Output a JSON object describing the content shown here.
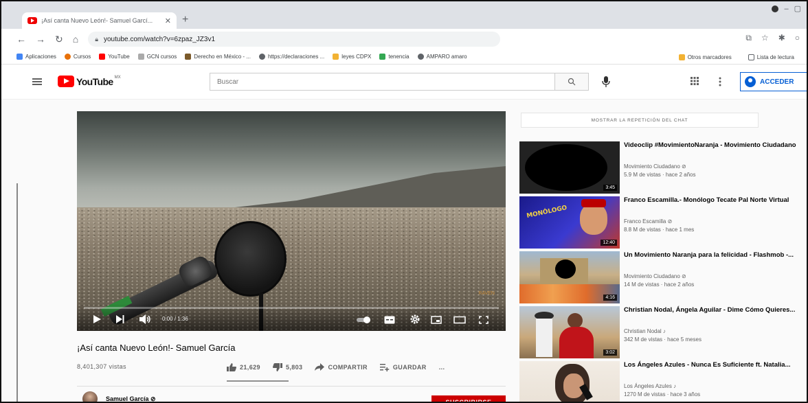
{
  "browser": {
    "tab_title": "¡Así canta Nuevo León!- Samuel Garcí... ",
    "tab_close": "✕",
    "new_tab": "+",
    "url": "youtube.com/watch?v=6zpaz_JZ3v1",
    "bookmarks": [
      "Aplicaciones",
      "Cursos",
      "YouTube",
      "GCN cursos",
      "Derecho en México - ...",
      "https://declaraciones ...",
      "leyes CDPX",
      "tenencia",
      "AMPARO amaro"
    ],
    "bookmarks_right": [
      "Otros marcadores",
      "Lista de lectura"
    ]
  },
  "youtube": {
    "logo_text": "YouTube",
    "logo_country": "MX",
    "search_placeholder": "Buscar",
    "signin_label": "ACCEDER"
  },
  "player": {
    "time": "0:00 / 1:36",
    "progress": 0.0,
    "watermark": "RAVEN"
  },
  "video": {
    "title": "¡Así canta Nuevo León!- Samuel García",
    "views": "8,401,307 vistas",
    "likes": "21,629",
    "dislikes": "5,803",
    "share_label": "COMPARTIR",
    "save_label": "GUARDAR",
    "more": "...",
    "channel": "Samuel García ⊘",
    "subscribe_label": "SUSCRIBIRSE"
  },
  "sidebar": {
    "chat_replay": "MOSTRAR LA REPETICIÓN DEL CHAT",
    "recommendations": [
      {
        "title": "Videoclip #MovimientoNaranja - Movimiento Ciudadano",
        "channel": "Movimiento Ciudadano ⊘",
        "meta": "5.9 M de vistas · hace 2 años",
        "duration": "3:45"
      },
      {
        "title": "Franco Escamilla.- Monólogo Tecate Pal Norte Virtual",
        "channel": "Franco Escamilla ⊘",
        "meta": "8.8 M de vistas · hace 1 mes",
        "duration": "12:40"
      },
      {
        "title": "Un Movimiento Naranja para la felicidad - Flashmob -...",
        "channel": "Movimiento Ciudadano ⊘",
        "meta": "14 M de vistas · hace 2 años",
        "duration": "4:16"
      },
      {
        "title": "Christian Nodal, Ángela Aguilar - Dime Cómo Quieres...",
        "channel": "Christian Nodal ♪",
        "meta": "342 M de vistas · hace 5 meses",
        "duration": "3:02"
      },
      {
        "title": "Los Ángeles Azules - Nunca Es Suficiente ft. Natalia...",
        "channel": "Los Ángeles Azules ♪",
        "meta": "1270 M de vistas · hace 3 años",
        "duration": ""
      }
    ]
  },
  "colors": {
    "brand": "#ff0000",
    "accent": "#065fd4",
    "subscribe": "#cc0000"
  }
}
